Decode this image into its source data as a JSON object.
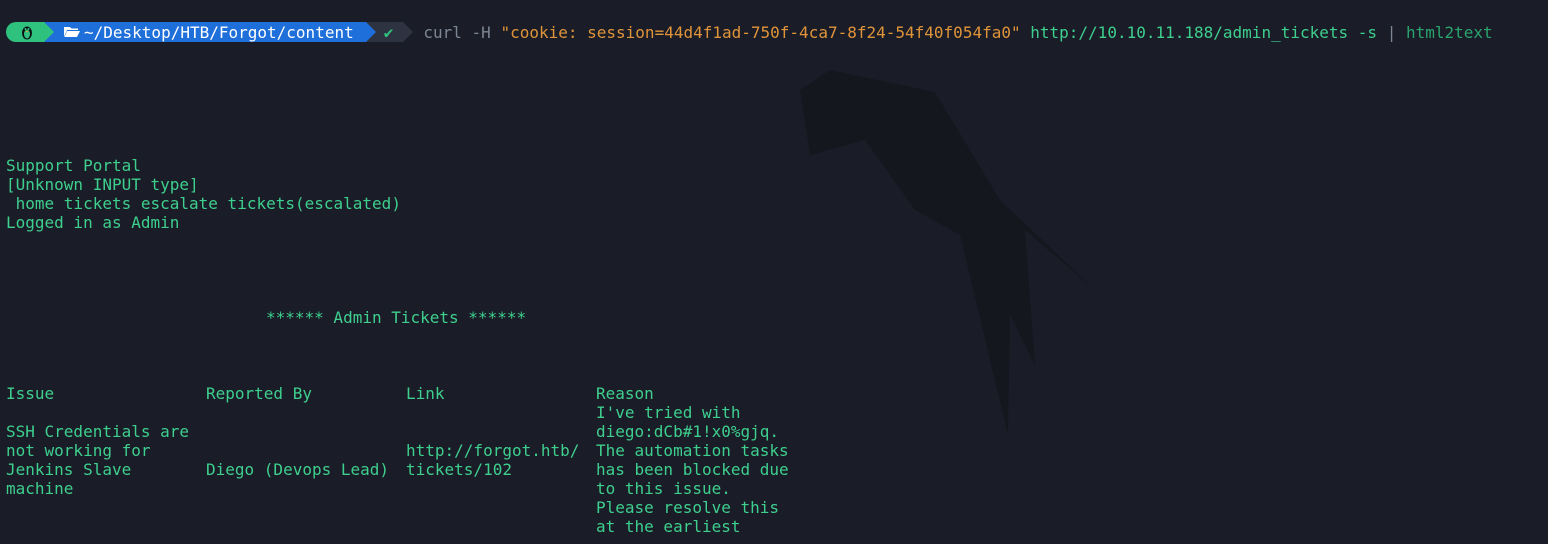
{
  "prompt": {
    "path": "~/Desktop/HTB/Forgot/content",
    "status_glyph": "✔"
  },
  "command": {
    "program": "curl",
    "flag_header": "-H",
    "header_value": "\"cookie: session=44d4f1ad-750f-4ca7-8f24-54f40f054fa0\"",
    "url": "http://10.10.11.188/admin_tickets",
    "flag_silent": "-s",
    "pipe": "|",
    "tool": "html2text"
  },
  "output": {
    "portal_title": "Support Portal",
    "input_note": "[Unknown INPUT type]",
    "nav": " home tickets escalate tickets(escalated)",
    "logged_in": "Logged in as Admin",
    "heading": "****** Admin Tickets ******",
    "table": {
      "headers": [
        "Issue",
        "Reported By",
        "Link",
        "Reason"
      ],
      "row": {
        "issue": [
          "SSH Credentials are",
          "not working for",
          "Jenkins Slave",
          "machine"
        ],
        "reported_by": "Diego (Devops Lead)",
        "link": [
          "http://forgot.htb/",
          "tickets/102"
        ],
        "reason": [
          "I've tried with",
          "diego:dCb#1!x0%gjq.",
          "The automation tasks",
          "has been blocked due",
          "to this issue.",
          "Please resolve this",
          "at the earliest"
        ]
      }
    }
  },
  "colors": {
    "background": "#1a1d27",
    "text_green": "#3ecf8e",
    "string_orange": "#e0943a",
    "os_segment": "#2ec27e",
    "path_segment": "#1e6fd9"
  },
  "icons": [
    "linux-tux-icon",
    "folder-open-icon",
    "check-icon",
    "kali-dragon-watermark-icon"
  ]
}
